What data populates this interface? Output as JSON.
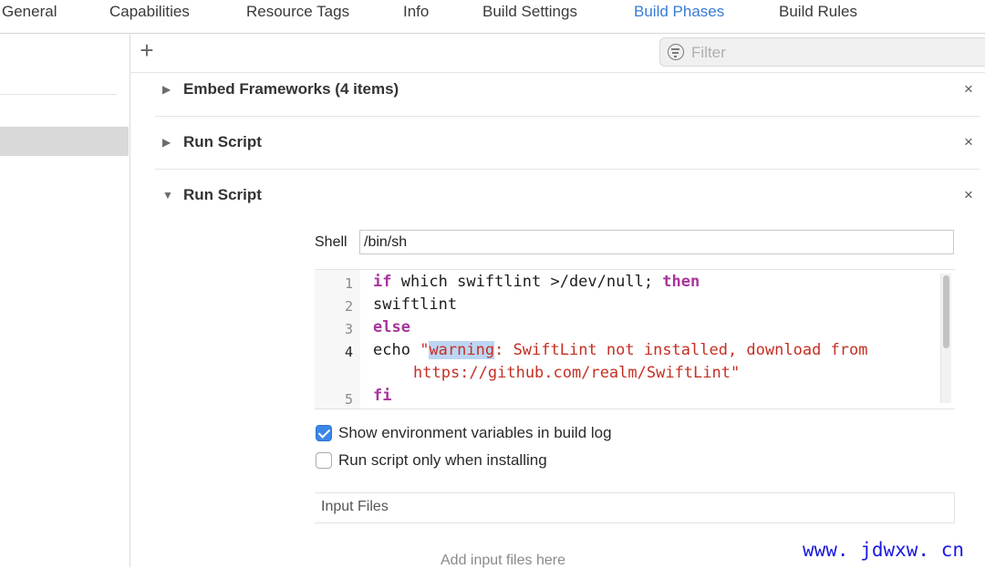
{
  "tabs": [
    {
      "label": "General",
      "active": false
    },
    {
      "label": "Capabilities",
      "active": false
    },
    {
      "label": "Resource Tags",
      "active": false
    },
    {
      "label": "Info",
      "active": false
    },
    {
      "label": "Build Settings",
      "active": false
    },
    {
      "label": "Build Phases",
      "active": true
    },
    {
      "label": "Build Rules",
      "active": false
    }
  ],
  "toolbar": {
    "add_glyph": "+",
    "filter_placeholder": "Filter",
    "filter_icon": "filter-circle-icon"
  },
  "phases": [
    {
      "title": "Embed Frameworks (4 items)",
      "expanded": false,
      "close": "×"
    },
    {
      "title": "Run Script",
      "expanded": false,
      "close": "×"
    },
    {
      "title": "Run Script",
      "expanded": true,
      "close": "×"
    }
  ],
  "disclosure": {
    "collapsed": "▶",
    "expanded": "▼"
  },
  "run_script": {
    "shell_label": "Shell",
    "shell_value": "/bin/sh",
    "line_numbers": [
      "1",
      "2",
      "3",
      "4",
      "5"
    ],
    "code": {
      "l1_kw1": "if",
      "l1_mid": " which swiftlint >/dev/null; ",
      "l1_kw2": "then",
      "l2": "swiftlint",
      "l3_kw": "else",
      "l4_cmd": "echo ",
      "l4_q": "\"",
      "l4_hl": "warning",
      "l4_rest": ": SwiftLint not installed, download from",
      "l4_wrap": "https://github.com/realm/SwiftLint\"",
      "l5_kw": "fi"
    },
    "show_env_label": "Show environment variables in build log",
    "show_env_checked": true,
    "install_only_label": "Run script only when installing",
    "install_only_checked": false,
    "input_files_label": "Input Files",
    "add_input_files": "Add input files here"
  },
  "watermark": "www. jdwxw. cn",
  "colors": {
    "active_tab": "#3a7bd5",
    "keyword": "#a8359c",
    "string": "#c62f24",
    "checkbox_on": "#3b86e8"
  }
}
